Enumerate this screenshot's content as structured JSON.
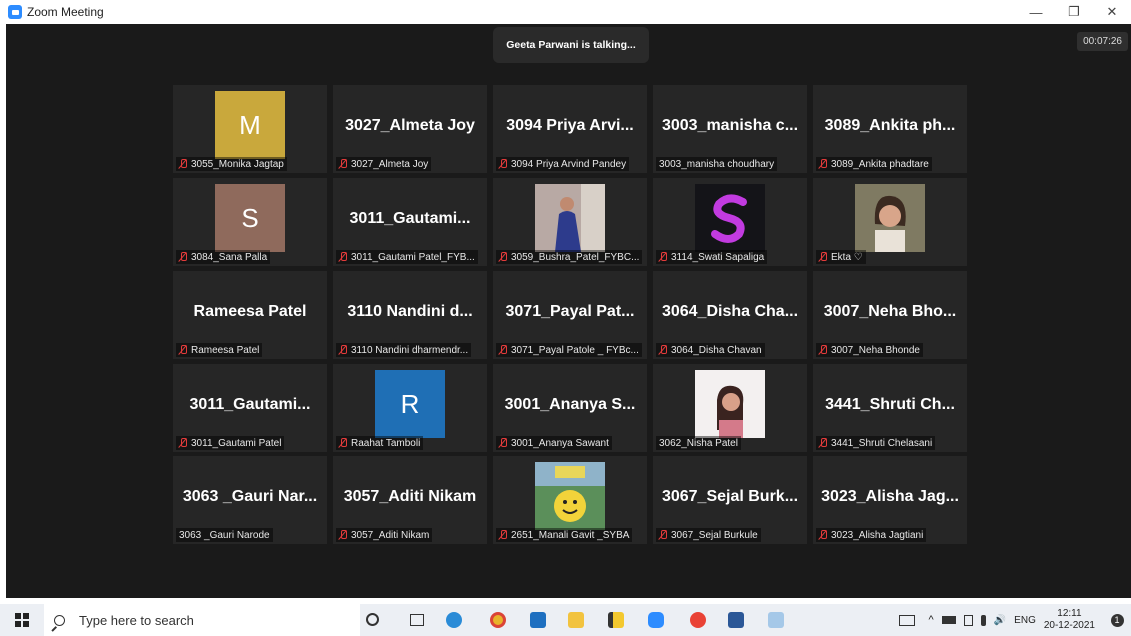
{
  "window": {
    "title": "Zoom Meeting",
    "minimize": "—",
    "maximize": "❐",
    "close": "✕"
  },
  "meeting": {
    "talking": "Geeta Parwani is talking...",
    "timer": "00:07:26",
    "tiles": [
      {
        "name": "3055_Monika Jagtap",
        "avatar_letter": "M",
        "avatar_color": "#c9a83c",
        "muted": true
      },
      {
        "name": "3027_Almeta Joy",
        "display": "3027_Almeta Joy",
        "muted": true
      },
      {
        "name": "3094 Priya Arvind Pandey",
        "display": "3094 Priya Arvi...",
        "muted": true
      },
      {
        "name": "3003_manisha choudhary",
        "display": "3003_manisha c...",
        "muted": false
      },
      {
        "name": "3089_Ankita phadtare",
        "display": "3089_Ankita ph...",
        "muted": true
      },
      {
        "name": "3084_Sana Palla",
        "avatar_letter": "S",
        "avatar_color": "#8f6a5c",
        "muted": true
      },
      {
        "name": "3011_Gautami Patel_FYB...",
        "display": "3011_Gautami...",
        "muted": true
      },
      {
        "name": "3059_Bushra_Patel_FYBC...",
        "photo": "photo",
        "muted": true
      },
      {
        "name": "3114_Swati Sapaliga",
        "photo": "logo-s",
        "muted": true
      },
      {
        "name": "Ekta ♡",
        "photo": "photo2",
        "muted": true
      },
      {
        "name": "Rameesa Patel",
        "display": "Rameesa Patel",
        "muted": true
      },
      {
        "name": "3110 Nandini dharmendr...",
        "display": "3110 Nandini d...",
        "muted": true
      },
      {
        "name": "3071_Payal Patole _ FYBc...",
        "display": "3071_Payal Pat...",
        "muted": true
      },
      {
        "name": "3064_Disha Chavan",
        "display": "3064_Disha Cha...",
        "muted": true
      },
      {
        "name": "3007_Neha Bhonde",
        "display": "3007_Neha Bho...",
        "muted": true
      },
      {
        "name": "3011_Gautami Patel",
        "display": "3011_Gautami...",
        "muted": true
      },
      {
        "name": "Raahat Tamboli",
        "avatar_letter": "R",
        "avatar_color": "#1f6fb5",
        "muted": true
      },
      {
        "name": "3001_Ananya Sawant",
        "display": "3001_Ananya S...",
        "muted": true
      },
      {
        "name": "3062_Nisha Patel",
        "photo": "photo3",
        "muted": false
      },
      {
        "name": "3441_Shruti Chelasani",
        "display": "3441_Shruti Ch...",
        "muted": true
      },
      {
        "name": "3063 _Gauri Narode",
        "display": "3063 _Gauri Nar...",
        "muted": false
      },
      {
        "name": "3057_Aditi Nikam",
        "display": "3057_Aditi Nikam",
        "muted": true
      },
      {
        "name": "2651_Manali Gavit _SYBA",
        "photo": "smiley",
        "muted": true
      },
      {
        "name": "3067_Sejal Burkule",
        "display": "3067_Sejal Burk...",
        "muted": true
      },
      {
        "name": "3023_Alisha Jagtiani",
        "display": "3023_Alisha Jag...",
        "muted": true
      }
    ]
  },
  "taskbar": {
    "search_placeholder": "Type here to search",
    "time": "12:11",
    "date": "20-12-2021",
    "lang": "ENG",
    "notifications": "1"
  }
}
